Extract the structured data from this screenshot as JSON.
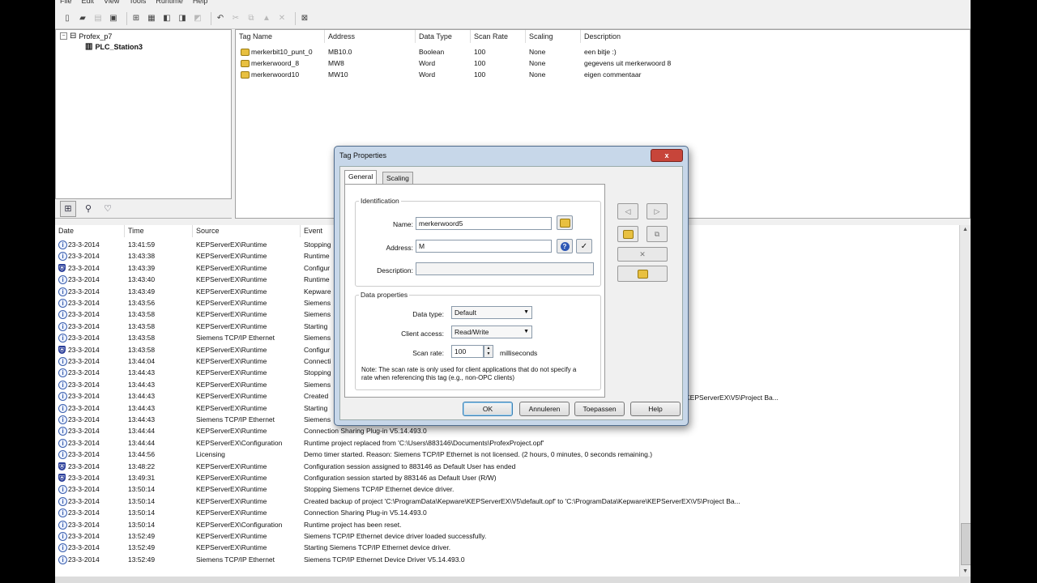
{
  "menu": [
    "File",
    "Edit",
    "View",
    "Tools",
    "Runtime",
    "Help"
  ],
  "tree": {
    "root": "Profex_p7",
    "child": "PLC_Station3"
  },
  "tags": {
    "columns": [
      "Tag Name",
      "Address",
      "Data Type",
      "Scan Rate",
      "Scaling",
      "Description"
    ],
    "rows": [
      {
        "name": "merkerbit10_punt_0",
        "address": "MB10.0",
        "type": "Boolean",
        "scan": "100",
        "scaling": "None",
        "desc": "een bitje :)"
      },
      {
        "name": "merkerwoord_8",
        "address": "MW8",
        "type": "Word",
        "scan": "100",
        "scaling": "None",
        "desc": "gegevens uit merkerwoord 8"
      },
      {
        "name": "merkerwoord10",
        "address": "MW10",
        "type": "Word",
        "scan": "100",
        "scaling": "None",
        "desc": "eigen commentaar"
      }
    ]
  },
  "events": {
    "columns": [
      "Date",
      "Time",
      "Source",
      "Event"
    ],
    "rows": [
      {
        "icon": "info",
        "date": "23-3-2014",
        "time": "13:41:59",
        "source": "KEPServerEX\\Runtime",
        "event": "Stopping"
      },
      {
        "icon": "info",
        "date": "23-3-2014",
        "time": "13:43:38",
        "source": "KEPServerEX\\Runtime",
        "event": "Runtime"
      },
      {
        "icon": "sec",
        "date": "23-3-2014",
        "time": "13:43:39",
        "source": "KEPServerEX\\Runtime",
        "event": "Configur"
      },
      {
        "icon": "info",
        "date": "23-3-2014",
        "time": "13:43:40",
        "source": "KEPServerEX\\Runtime",
        "event": "Runtime"
      },
      {
        "icon": "info",
        "date": "23-3-2014",
        "time": "13:43:49",
        "source": "KEPServerEX\\Runtime",
        "event": "Kepware"
      },
      {
        "icon": "info",
        "date": "23-3-2014",
        "time": "13:43:56",
        "source": "KEPServerEX\\Runtime",
        "event": "Siemens"
      },
      {
        "icon": "info",
        "date": "23-3-2014",
        "time": "13:43:58",
        "source": "KEPServerEX\\Runtime",
        "event": "Siemens"
      },
      {
        "icon": "info",
        "date": "23-3-2014",
        "time": "13:43:58",
        "source": "KEPServerEX\\Runtime",
        "event": "Starting"
      },
      {
        "icon": "info",
        "date": "23-3-2014",
        "time": "13:43:58",
        "source": "Siemens TCP/IP Ethernet",
        "event": "Siemens"
      },
      {
        "icon": "sec",
        "date": "23-3-2014",
        "time": "13:43:58",
        "source": "KEPServerEX\\Runtime",
        "event": "Configur"
      },
      {
        "icon": "info",
        "date": "23-3-2014",
        "time": "13:44:04",
        "source": "KEPServerEX\\Runtime",
        "event": "Connecti"
      },
      {
        "icon": "info",
        "date": "23-3-2014",
        "time": "13:44:43",
        "source": "KEPServerEX\\Runtime",
        "event": "Stopping"
      },
      {
        "icon": "info",
        "date": "23-3-2014",
        "time": "13:44:43",
        "source": "KEPServerEX\\Runtime",
        "event": "Siemens"
      },
      {
        "icon": "info",
        "date": "23-3-2014",
        "time": "13:44:43",
        "source": "KEPServerEX\\Runtime",
        "event": "Created"
      },
      {
        "icon": "info",
        "date": "23-3-2014",
        "time": "13:44:43",
        "source": "KEPServerEX\\Runtime",
        "event": "Starting"
      },
      {
        "icon": "info",
        "date": "23-3-2014",
        "time": "13:44:43",
        "source": "Siemens TCP/IP Ethernet",
        "event": "Siemens"
      },
      {
        "icon": "info",
        "date": "23-3-2014",
        "time": "13:44:44",
        "source": "KEPServerEX\\Runtime",
        "event": "Connection Sharing Plug-in V5.14.493.0"
      },
      {
        "icon": "info",
        "date": "23-3-2014",
        "time": "13:44:44",
        "source": "KEPServerEX\\Configuration",
        "event": "Runtime project replaced from 'C:\\Users\\883146\\Documents\\ProfexProject.opf'"
      },
      {
        "icon": "info",
        "date": "23-3-2014",
        "time": "13:44:56",
        "source": "Licensing",
        "event": "Demo timer started. Reason: Siemens TCP/IP Ethernet is not licensed. (2 hours, 0 minutes, 0 seconds remaining.)"
      },
      {
        "icon": "sec",
        "date": "23-3-2014",
        "time": "13:48:22",
        "source": "KEPServerEX\\Runtime",
        "event": "Configuration session assigned to 883146 as Default User has ended"
      },
      {
        "icon": "sec",
        "date": "23-3-2014",
        "time": "13:49:31",
        "source": "KEPServerEX\\Runtime",
        "event": "Configuration session started by 883146 as Default User (R/W)"
      },
      {
        "icon": "info",
        "date": "23-3-2014",
        "time": "13:50:14",
        "source": "KEPServerEX\\Runtime",
        "event": "Stopping Siemens TCP/IP Ethernet device driver."
      },
      {
        "icon": "info",
        "date": "23-3-2014",
        "time": "13:50:14",
        "source": "KEPServerEX\\Runtime",
        "event": "Created backup of project 'C:\\ProgramData\\Kepware\\KEPServerEX\\V5\\default.opf' to 'C:\\ProgramData\\Kepware\\KEPServerEX\\V5\\Project Ba..."
      },
      {
        "icon": "info",
        "date": "23-3-2014",
        "time": "13:50:14",
        "source": "KEPServerEX\\Runtime",
        "event": "Connection Sharing Plug-in V5.14.493.0"
      },
      {
        "icon": "info",
        "date": "23-3-2014",
        "time": "13:50:14",
        "source": "KEPServerEX\\Configuration",
        "event": "Runtime project has been reset."
      },
      {
        "icon": "info",
        "date": "23-3-2014",
        "time": "13:52:49",
        "source": "KEPServerEX\\Runtime",
        "event": "Siemens TCP/IP Ethernet device driver loaded successfully."
      },
      {
        "icon": "info",
        "date": "23-3-2014",
        "time": "13:52:49",
        "source": "KEPServerEX\\Runtime",
        "event": "Starting Siemens TCP/IP Ethernet device driver."
      },
      {
        "icon": "info",
        "date": "23-3-2014",
        "time": "13:52:49",
        "source": "Siemens TCP/IP Ethernet",
        "event": "Siemens TCP/IP Ethernet Device Driver V5.14.493.0"
      }
    ],
    "overflow_texts": [
      "KEPServerEX\\V5\\Project Ba..."
    ]
  },
  "dialog": {
    "title": "Tag Properties",
    "close_label": "x",
    "tabs": [
      "General",
      "Scaling"
    ],
    "identification_label": "Identification",
    "name_label": "Name:",
    "name_value": "merkerwoord5",
    "address_label": "Address:",
    "address_value": "M",
    "description_label": "Description:",
    "description_value": "",
    "data_properties_label": "Data properties",
    "data_type_label": "Data type:",
    "data_type_value": "Default",
    "client_access_label": "Client access:",
    "client_access_value": "Read/Write",
    "scan_rate_label": "Scan rate:",
    "scan_rate_value": "100",
    "scan_rate_unit": "milliseconds",
    "note": "Note: The scan rate is only used for client applications that do not specify a rate when referencing this tag (e.g., non-OPC clients)",
    "buttons": {
      "ok": "OK",
      "cancel": "Annuleren",
      "apply": "Toepassen",
      "help": "Help"
    }
  },
  "colors": {
    "accent": "#3c7fb1",
    "close": "#c7453a",
    "dialog_frame": "#c7d7e9"
  }
}
